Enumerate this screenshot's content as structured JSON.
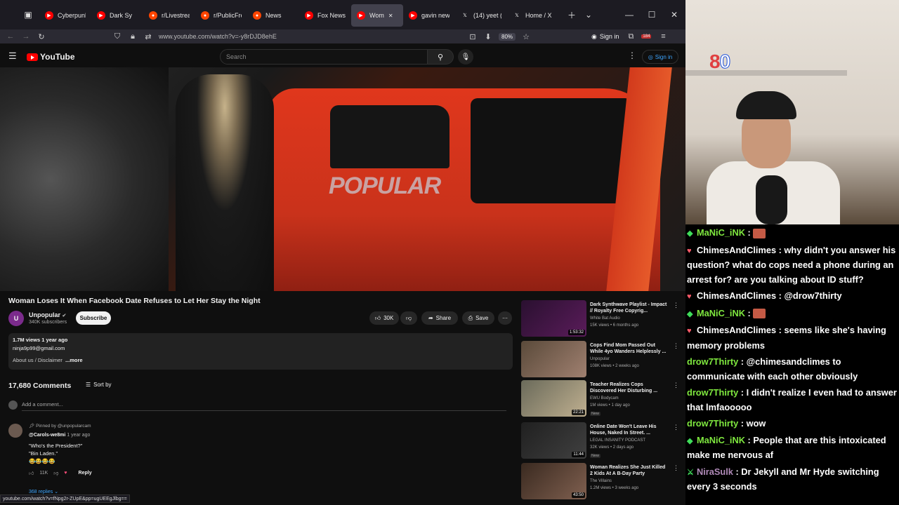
{
  "browser": {
    "tabs": [
      {
        "title": "Cyberpunk",
        "fav_color": "#ff0000",
        "fav_icon": "youtube-icon"
      },
      {
        "title": "Dark Sy",
        "fav_color": "#ff0000",
        "fav_icon": "youtube-icon"
      },
      {
        "title": "r/Livestream",
        "fav_color": "#ff4500",
        "fav_icon": "reddit-icon"
      },
      {
        "title": "r/PublicFre",
        "fav_color": "#ff4500",
        "fav_icon": "reddit-icon"
      },
      {
        "title": "News",
        "fav_color": "#ff4500",
        "fav_icon": "reddit-icon"
      },
      {
        "title": "Fox News -",
        "fav_color": "#ff0000",
        "fav_icon": "youtube-icon"
      },
      {
        "title": "Wom",
        "fav_color": "#ff0000",
        "fav_icon": "youtube-icon",
        "active": true
      },
      {
        "title": "gavin newso",
        "fav_color": "#ff0000",
        "fav_icon": "youtube-icon"
      },
      {
        "title": "(14) yeet (@",
        "fav_color": "#ffffff",
        "fav_icon": "x-icon"
      },
      {
        "title": "Home / X",
        "fav_color": "#ffffff",
        "fav_icon": "x-icon"
      }
    ],
    "url": "www.youtube.com/watch?v=-y8rDJD8ehE",
    "zoom": "80%",
    "sign_in": "Sign in",
    "ext_badge": "184",
    "status_url": "youtube.com/watch?v=fNpg2r-ZUpE&pp=ugUEEgJlbg=="
  },
  "youtube": {
    "logo_text": "YouTube",
    "search_placeholder": "Search",
    "sign_in": "Sign in",
    "video_watermark": "POPULAR",
    "video_title": "Woman Loses It When Facebook Date Refuses to Let Her Stay the Night",
    "channel": {
      "name": "Unpopular",
      "subs": "340K subscribers",
      "avatar_letter": "U"
    },
    "subscribe": "Subscribe",
    "likes": "30K",
    "share": "Share",
    "save": "Save",
    "description": {
      "meta": "1.7M views  1 year ago",
      "email": "ninja9p99@gmail.com",
      "about": "About us / Disclaimer",
      "more": "...more"
    },
    "comments_count": "17,680 Comments",
    "sort_by": "Sort by",
    "add_comment": "Add a comment...",
    "pinned_comment": {
      "pinned_label": "Pinned by @unpopularcam",
      "author": "@Carols-we8mi",
      "time": "1 year ago",
      "line1": "\"Who's the President?\"",
      "line2": "\"Bin Laden.\"",
      "line3": "😂😂😂😂",
      "likes": "11K",
      "reply": "Reply",
      "replies": "368 replies"
    },
    "related": [
      {
        "title": "Dark Synthwave Playlist - Impact // Royalty Free Copyrig...",
        "channel": "White Bat Audio",
        "views": "15K views • 6 months ago",
        "duration": "1:53:32",
        "new": "",
        "thumb": [
          "#2a1030",
          "#5a1c5a"
        ]
      },
      {
        "title": "Cops Find Mom Passed Out While 4yo Wanders Helplessly ...",
        "channel": "Unpopular",
        "views": "108K views • 2 weeks ago",
        "duration": "",
        "new": "",
        "thumb": [
          "#5a4a3a",
          "#a08070"
        ]
      },
      {
        "title": "Teacher Realizes Cops Discovered Her Disturbing ...",
        "channel": "EWU Bodycam",
        "views": "1M views • 1 day ago",
        "duration": "22:21",
        "new": "New",
        "thumb": [
          "#6a6a5a",
          "#c0b090"
        ]
      },
      {
        "title": "Online Date Won't Leave His House, Naked In Street. ...",
        "channel": "LEGAL INSANITY PODCAST",
        "views": "32K views • 2 days ago",
        "duration": "11:44",
        "new": "New",
        "thumb": [
          "#202020",
          "#404040"
        ]
      },
      {
        "title": "Woman Realizes She Just Killed 2 Kids At A B-Day Party",
        "channel": "The Villains",
        "views": "1.2M views • 3 weeks ago",
        "duration": "43:50",
        "new": "",
        "thumb": [
          "#3a2a20",
          "#806050"
        ]
      }
    ]
  },
  "stream": {
    "counter_red": "8",
    "counter_white": "0",
    "chat": [
      {
        "badge": "green",
        "user": "MaNiC_iNK",
        "user_color": "green",
        "text": "",
        "emote": true
      },
      {
        "badge": "heart",
        "user": "ChimesAndClimes",
        "user_color": "white",
        "text": "why didn't you answer his question? what do cops need a phone during an arrest for? are you talking about ID stuff?"
      },
      {
        "badge": "heart",
        "user": "ChimesAndClimes",
        "user_color": "white",
        "text": "@drow7thirty"
      },
      {
        "badge": "green",
        "user": "MaNiC_iNK",
        "user_color": "green",
        "text": "",
        "emote": true
      },
      {
        "badge": "heart",
        "user": "ChimesAndClimes",
        "user_color": "white",
        "text": "seems like she's having memory problems"
      },
      {
        "badge": "",
        "user": "drow7Thirty",
        "user_color": "green",
        "text": "@chimesandclimes to communicate with each other obviously"
      },
      {
        "badge": "",
        "user": "drow7Thirty",
        "user_color": "green",
        "text": "I didn't realize I even had to answer that lmfaooooo"
      },
      {
        "badge": "",
        "user": "drow7Thirty",
        "user_color": "green",
        "text": "wow"
      },
      {
        "badge": "green",
        "user": "MaNiC_iNK",
        "user_color": "green",
        "text": "People that are this intoxicated make me nervous af"
      },
      {
        "badge": "sword",
        "user": "NiraSulk",
        "user_color": "dim",
        "text": "Dr Jekyll and Mr Hyde switching every 3 seconds"
      }
    ]
  }
}
